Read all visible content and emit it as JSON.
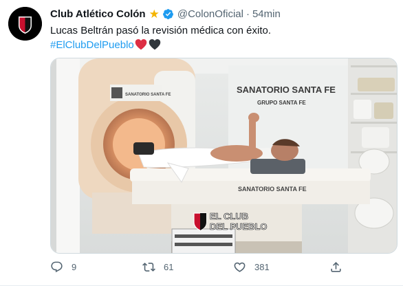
{
  "tweet": {
    "author_name": "Club Atlético Colón",
    "handle": "@ColonOficial",
    "separator": "·",
    "time": "54min",
    "text": "Lucas Beltrán pasó la revisión médica con éxito.",
    "hashtag": "#ElClubDelPueblo",
    "hashtag_emoji": [
      "red-heart",
      "black-heart"
    ],
    "badges": [
      "star-icon",
      "verified-icon"
    ]
  },
  "media": {
    "sign_top_line1": "SANATORIO SANTA FE",
    "sign_top_line2": "GRUPO SANTA FE",
    "scanner_label": "SANATORIO SANTA FE",
    "table_label": "SANATORIO SANTA FE",
    "watermark_line1": "EL CLUB",
    "watermark_line2": "DEL PUEBLO"
  },
  "actions": {
    "reply_count": "9",
    "retweet_count": "61",
    "like_count": "381"
  },
  "colors": {
    "accent": "#1d9bf0",
    "muted": "#536471",
    "club_red": "#c8102e"
  }
}
